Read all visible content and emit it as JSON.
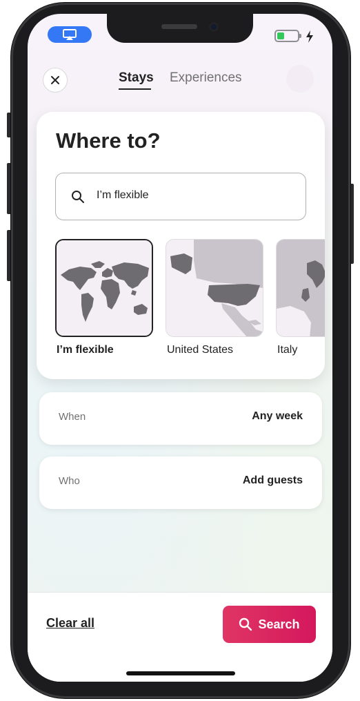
{
  "header": {
    "tabs": [
      {
        "label": "Stays",
        "active": true
      },
      {
        "label": "Experiences",
        "active": false
      }
    ],
    "close_icon": "close-icon"
  },
  "where": {
    "title": "Where to?",
    "search": {
      "value": "I’m flexible",
      "icon": "search-icon"
    },
    "regions": [
      {
        "label": "I’m flexible",
        "selected": true
      },
      {
        "label": "United States",
        "selected": false
      },
      {
        "label": "Italy",
        "selected": false
      }
    ]
  },
  "when": {
    "label": "When",
    "value": "Any week"
  },
  "who": {
    "label": "Who",
    "value": "Add guests"
  },
  "footer": {
    "clear_label": "Clear all",
    "search_label": "Search"
  },
  "colors": {
    "accent": "#d91c5c",
    "airplay": "#3478f6",
    "battery": "#34c759"
  }
}
